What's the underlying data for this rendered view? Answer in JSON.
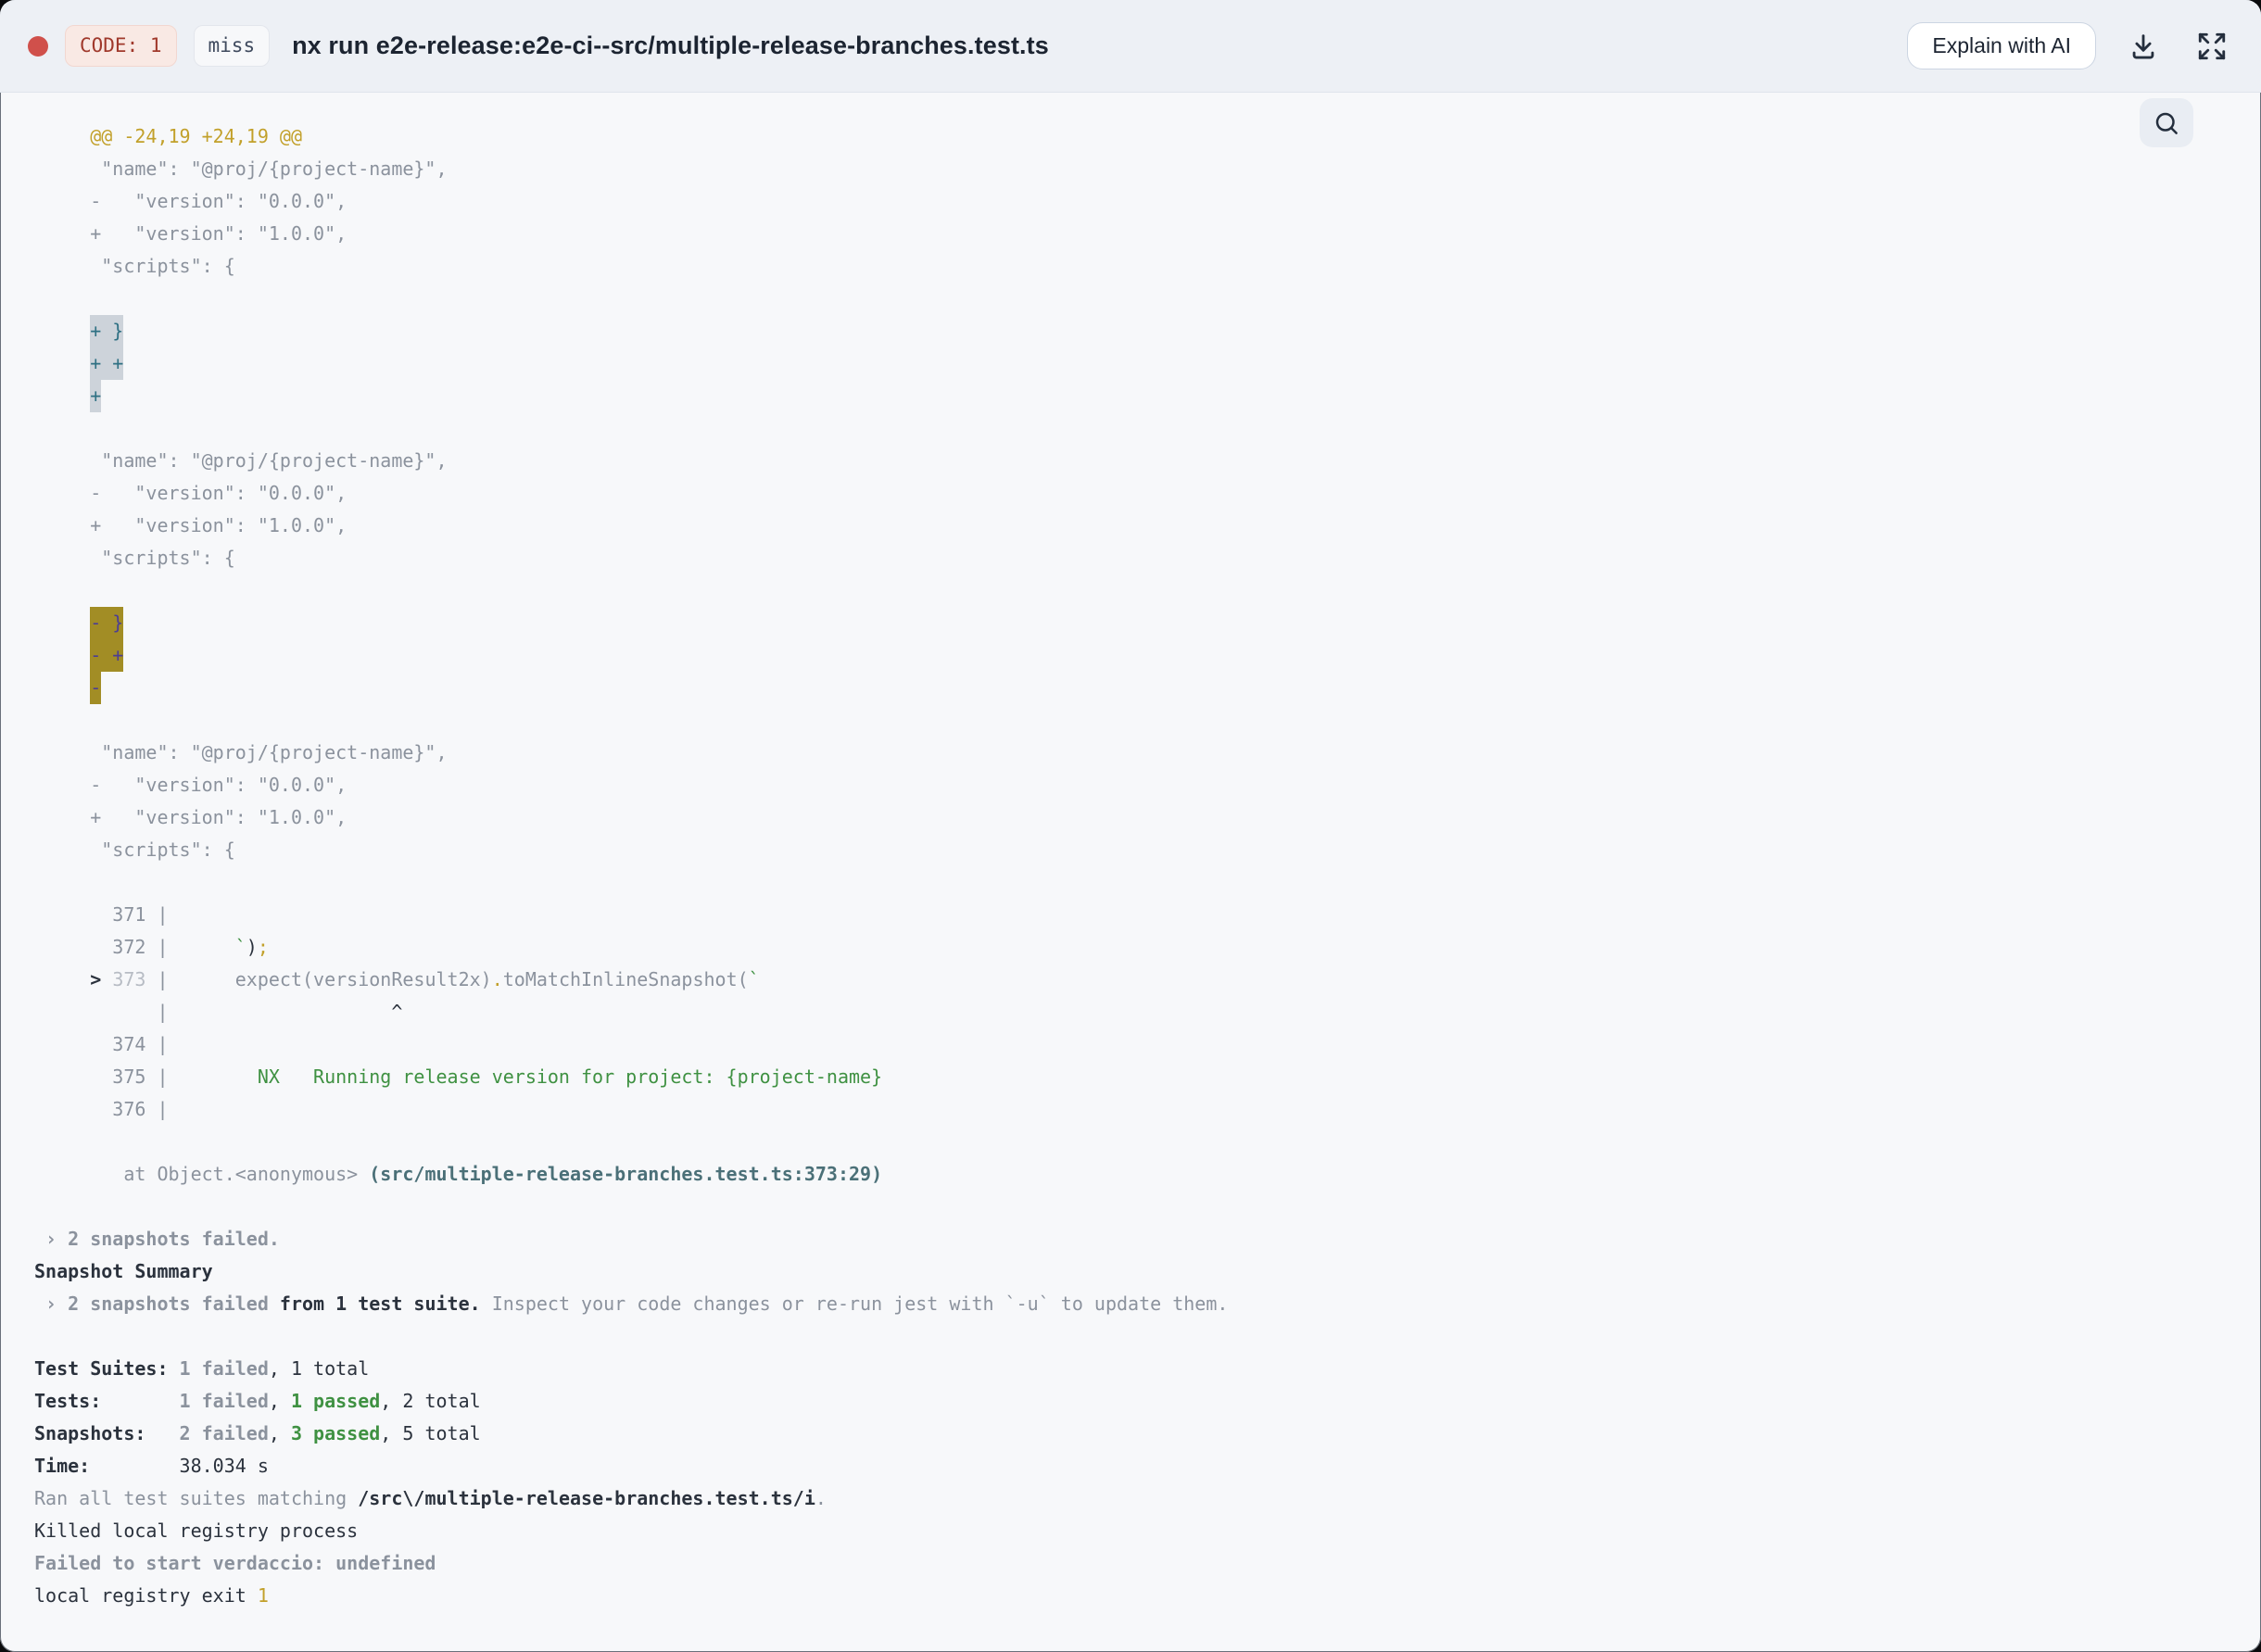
{
  "header": {
    "exit_code_badge": "CODE: 1",
    "cache_status_badge": "miss",
    "title": "nx run e2e-release:e2e-ci--src/multiple-release-branches.test.ts",
    "explain_button_label": "Explain with AI"
  },
  "icons": [
    "status-dot",
    "download-icon",
    "expand-icon",
    "search-icon"
  ],
  "colors": {
    "dot": "#d0504b",
    "header_bg": "#edf0f5",
    "panel_bg": "#f7f8fa",
    "badge_code_bg": "#f9e9e4",
    "badge_code_border": "#f2d7d0",
    "badge_code_text": "#a0392c",
    "badge_miss_bg": "#f7f8fa",
    "badge_miss_border": "#e3e6ec",
    "badge_miss_text": "#3f4a5e",
    "title_text": "#1c2431",
    "gray": "#8b929d",
    "gray_dim": "#b7bcc4",
    "dark": "#2b323d",
    "gold": "#c2a02a",
    "green": "#3f9142",
    "teal_path": "#4b7078",
    "hl_add_bg": "#cdd3da",
    "hl_add_text": "#2e7083",
    "hl_del_bg": "#a28d25",
    "hl_del_text": "#4c3e93"
  },
  "terminal": {
    "lines": [
      [
        {
          "s": "go",
          "t": "     @@ -24,19 +24,19 @@"
        }
      ],
      [
        {
          "s": "g",
          "t": "      \"name\": \"@proj/{project-name}\","
        }
      ],
      [
        {
          "s": "g",
          "t": "     -   \"version\": \"0.0.0\","
        }
      ],
      [
        {
          "s": "g",
          "t": "     +   \"version\": \"1.0.0\","
        }
      ],
      [
        {
          "s": "g",
          "t": "      \"scripts\": {"
        }
      ],
      [],
      [
        {
          "s": "g",
          "t": "     "
        },
        {
          "s": "ha",
          "t": "+ }"
        }
      ],
      [
        {
          "s": "g",
          "t": "     "
        },
        {
          "s": "ha",
          "t": "+ +"
        }
      ],
      [
        {
          "s": "g",
          "t": "     "
        },
        {
          "s": "ha",
          "t": "+"
        }
      ],
      [],
      [
        {
          "s": "g",
          "t": "      \"name\": \"@proj/{project-name}\","
        }
      ],
      [
        {
          "s": "g",
          "t": "     -   \"version\": \"0.0.0\","
        }
      ],
      [
        {
          "s": "g",
          "t": "     +   \"version\": \"1.0.0\","
        }
      ],
      [
        {
          "s": "g",
          "t": "      \"scripts\": {"
        }
      ],
      [],
      [
        {
          "s": "g",
          "t": "     "
        },
        {
          "s": "hd",
          "t": "- }"
        }
      ],
      [
        {
          "s": "g",
          "t": "     "
        },
        {
          "s": "hd",
          "t": "- +"
        }
      ],
      [
        {
          "s": "g",
          "t": "     "
        },
        {
          "s": "hd",
          "t": "-"
        }
      ],
      [],
      [
        {
          "s": "g",
          "t": "      \"name\": \"@proj/{project-name}\","
        }
      ],
      [
        {
          "s": "g",
          "t": "     -   \"version\": \"0.0.0\","
        }
      ],
      [
        {
          "s": "g",
          "t": "     +   \"version\": \"1.0.0\","
        }
      ],
      [
        {
          "s": "g",
          "t": "      \"scripts\": {"
        }
      ],
      [],
      [
        {
          "s": "g",
          "t": "       371 |"
        }
      ],
      [
        {
          "s": "g",
          "t": "       372 |      "
        },
        {
          "s": "gr",
          "t": "`"
        },
        {
          "s": "d",
          "t": ")"
        },
        {
          "s": "go",
          "t": ";"
        }
      ],
      [
        {
          "s": "g",
          "t": "     "
        },
        {
          "s": "db",
          "t": ">"
        },
        {
          "s": "g",
          "t": " "
        },
        {
          "s": "dim",
          "t": "373"
        },
        {
          "s": "g",
          "t": " |      "
        },
        {
          "s": "g",
          "t": "expect(versionResult2x)"
        },
        {
          "s": "go",
          "t": "."
        },
        {
          "s": "g",
          "t": "toMatchInlineSnapshot("
        },
        {
          "s": "gr",
          "t": "`"
        }
      ],
      [
        {
          "s": "g",
          "t": "           |"
        },
        {
          "s": "d",
          "t": "                    ^"
        }
      ],
      [
        {
          "s": "g",
          "t": "       374 |"
        }
      ],
      [
        {
          "s": "g",
          "t": "       375 |"
        },
        {
          "s": "gr",
          "t": "        NX   Running release version for project: {project-name}"
        }
      ],
      [
        {
          "s": "g",
          "t": "       376 |"
        }
      ],
      [],
      [
        {
          "s": "g",
          "t": "        at Object.<anonymous> "
        },
        {
          "s": "tl",
          "t": "(src/multiple-release-branches.test.ts:373:29)"
        }
      ],
      [],
      [
        {
          "s": "gb",
          "t": " › 2 snapshots failed."
        }
      ],
      [
        {
          "s": "db",
          "t": "Snapshot Summary"
        }
      ],
      [
        {
          "s": "gb",
          "t": " › 2 snapshots failed"
        },
        {
          "s": "db",
          "t": " from 1 test suite."
        },
        {
          "s": "g",
          "t": " Inspect your code changes or re-run jest with `-u` to update them."
        }
      ],
      [],
      [
        {
          "s": "db",
          "t": "Test Suites: "
        },
        {
          "s": "gb",
          "t": "1 failed"
        },
        {
          "s": "d",
          "t": ", 1 total"
        }
      ],
      [
        {
          "s": "db",
          "t": "Tests:       "
        },
        {
          "s": "gb",
          "t": "1 failed"
        },
        {
          "s": "d",
          "t": ", "
        },
        {
          "s": "grb",
          "t": "1 passed"
        },
        {
          "s": "d",
          "t": ", 2 total"
        }
      ],
      [
        {
          "s": "db",
          "t": "Snapshots:   "
        },
        {
          "s": "gb",
          "t": "2 failed"
        },
        {
          "s": "d",
          "t": ", "
        },
        {
          "s": "grb",
          "t": "3 passed"
        },
        {
          "s": "d",
          "t": ", 5 total"
        }
      ],
      [
        {
          "s": "db",
          "t": "Time:        "
        },
        {
          "s": "d",
          "t": "38.034 s"
        }
      ],
      [
        {
          "s": "g",
          "t": "Ran all test suites matching "
        },
        {
          "s": "db",
          "t": "/src\\/multiple-release-branches.test.ts/i"
        },
        {
          "s": "g",
          "t": "."
        }
      ],
      [
        {
          "s": "d",
          "t": "Killed local registry process"
        }
      ],
      [
        {
          "s": "gb",
          "t": "Failed to start verdaccio: undefined"
        }
      ],
      [
        {
          "s": "d",
          "t": "local registry exit "
        },
        {
          "s": "go",
          "t": "1"
        }
      ]
    ]
  }
}
